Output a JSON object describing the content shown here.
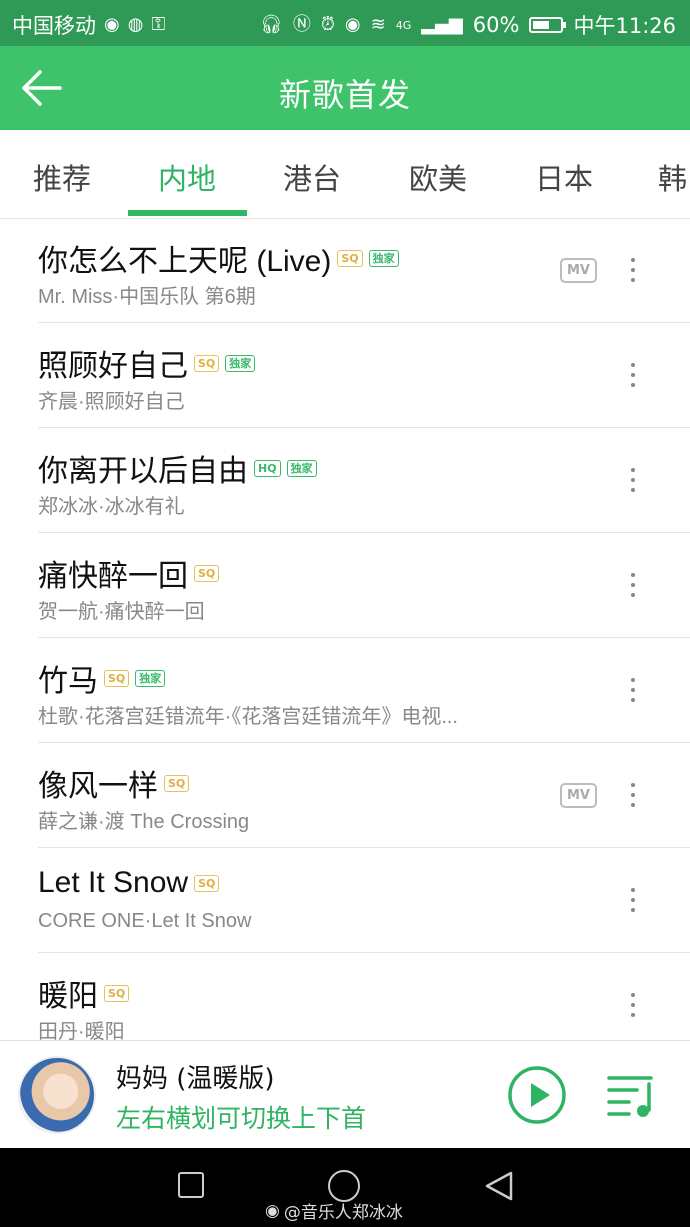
{
  "status": {
    "carrier": "中国移动",
    "network": "4G",
    "battery": "60%",
    "battery_level": 0.6,
    "time": "中午11:26"
  },
  "header": {
    "title": "新歌首发",
    "back_icon": "arrow-left-icon"
  },
  "tabs": [
    {
      "label": "推荐",
      "active": false
    },
    {
      "label": "内地",
      "active": true
    },
    {
      "label": "港台",
      "active": false
    },
    {
      "label": "欧美",
      "active": false
    },
    {
      "label": "日本",
      "active": false
    },
    {
      "label": "韩",
      "active": false
    }
  ],
  "songs": [
    {
      "title": "你怎么不上天呢 (Live)",
      "quality": "SQ",
      "exclusive": "独家",
      "subtitle": "Mr. Miss·中国乐队 第6期",
      "mv": "MV"
    },
    {
      "title": "照顾好自己",
      "quality": "SQ",
      "exclusive": "独家",
      "subtitle": "齐晨·照顾好自己"
    },
    {
      "title": "你离开以后自由",
      "quality": "HQ",
      "exclusive": "独家",
      "subtitle": "郑冰冰·冰冰有礼"
    },
    {
      "title": "痛快醉一回",
      "quality": "SQ",
      "subtitle": "贺一航·痛快醉一回"
    },
    {
      "title": "竹马",
      "quality": "SQ",
      "exclusive": "独家",
      "subtitle": "杜歌·花落宫廷错流年·《花落宫廷错流年》电视..."
    },
    {
      "title": "像风一样",
      "quality": "SQ",
      "subtitle": "薛之谦·渡 The Crossing",
      "mv": "MV"
    },
    {
      "title": "Let It Snow",
      "quality": "SQ",
      "subtitle": "CORE ONE·Let It Snow"
    },
    {
      "title": "暖阳",
      "quality": "SQ",
      "subtitle": "田丹·暖阳"
    }
  ],
  "player": {
    "title": "妈妈 (温暖版)",
    "hint": "左右横划可切换上下首"
  },
  "watermark": "@音乐人郑冰冰",
  "colors": {
    "header_green": "#3ec36b",
    "status_green": "#2f9a55",
    "accent_green": "#2fb463",
    "sq_gold": "#e0b040"
  }
}
